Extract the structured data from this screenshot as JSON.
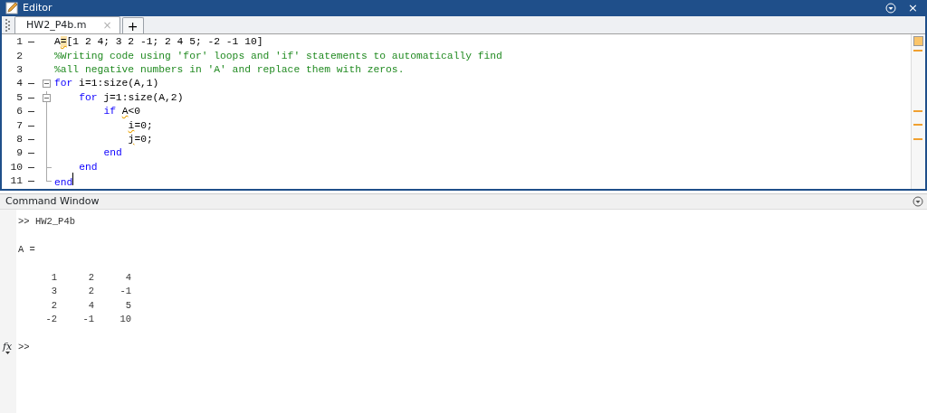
{
  "editor": {
    "title": "Editor",
    "close": "×",
    "tabs": [
      {
        "label": "HW2_P4b.m",
        "close": "×",
        "selected": true
      }
    ],
    "new_tab": "+",
    "lines": [
      {
        "number": "1",
        "executable": true,
        "fold_toggle": false,
        "fold_end": false,
        "tokens": [
          {
            "kind": "code",
            "text": "A"
          },
          {
            "kind": "warn",
            "text": "="
          },
          {
            "kind": "code",
            "text": "[1 2 4; 3 2 -1; 2 4 5; -2 -1 10]"
          }
        ]
      },
      {
        "number": "2",
        "executable": false,
        "fold_toggle": false,
        "fold_end": false,
        "tokens": [
          {
            "kind": "comment",
            "text": "%Writing code using 'for' loops and 'if' statements to automatically find"
          }
        ]
      },
      {
        "number": "3",
        "executable": false,
        "fold_toggle": false,
        "fold_end": false,
        "tokens": [
          {
            "kind": "comment",
            "text": "%all negative numbers in 'A' and replace them with zeros."
          }
        ]
      },
      {
        "number": "4",
        "executable": true,
        "fold_toggle": true,
        "fold_end": false,
        "tokens": [
          {
            "kind": "keyword",
            "text": "for"
          },
          {
            "kind": "code",
            "gap": true,
            "text": "i=1:size(A,1)"
          }
        ],
        "children": [
          {
            "number": "5",
            "executable": true,
            "fold_toggle": true,
            "fold_end": false,
            "tokens": [
              {
                "kind": "keyword",
                "text": "for"
              },
              {
                "kind": "code",
                "gap": true,
                "text": "j=1:size(A,2)"
              }
            ],
            "children": [
              {
                "number": "6",
                "executable": true,
                "fold_toggle": false,
                "fold_end": false,
                "tokens": [
                  {
                    "kind": "keyword",
                    "text": "if"
                  },
                  {
                    "kind": "squiggle",
                    "gap": true,
                    "text": "A"
                  },
                  {
                    "kind": "code",
                    "text": "<0"
                  }
                ],
                "children": [
                  {
                    "number": "7",
                    "executable": true,
                    "fold_toggle": false,
                    "fold_end": false,
                    "tokens": [
                      {
                        "kind": "squiggle",
                        "text": "i"
                      },
                      {
                        "kind": "code",
                        "text": "=0;"
                      }
                    ]
                  },
                  {
                    "number": "8",
                    "executable": true,
                    "fold_toggle": false,
                    "fold_end": false,
                    "tokens": [
                      {
                        "kind": "squiggle",
                        "text": "j"
                      },
                      {
                        "kind": "code",
                        "text": "=0;"
                      }
                    ]
                  }
                ]
              },
              {
                "number": "9",
                "executable": true,
                "fold_toggle": false,
                "fold_end": false,
                "tokens": [
                  {
                    "kind": "keyword",
                    "text": "end"
                  }
                ]
              }
            ]
          },
          {
            "number": "10",
            "executable": true,
            "fold_toggle": false,
            "fold_end": true,
            "tokens": [
              {
                "kind": "keyword",
                "text": "end"
              }
            ]
          }
        ]
      },
      {
        "number": "11",
        "executable": true,
        "fold_toggle": false,
        "fold_end": true,
        "cursor": true,
        "tokens": [
          {
            "kind": "keyword",
            "text": "end"
          }
        ]
      }
    ]
  },
  "command_window": {
    "title": "Command Window",
    "lines": [
      {
        "kind": "command",
        "prompt": ">>",
        "text": "HW2_P4b"
      },
      {
        "kind": "output",
        "text": "A ="
      },
      {
        "kind": "matrix",
        "rows": [
          [
            "1",
            "2",
            "4"
          ],
          [
            "3",
            "2",
            "-1"
          ],
          [
            "2",
            "4",
            "5"
          ],
          [
            "-2",
            "-1",
            "10"
          ]
        ]
      }
    ],
    "input": {
      "fx": "fx",
      "prompt": ">>"
    }
  }
}
